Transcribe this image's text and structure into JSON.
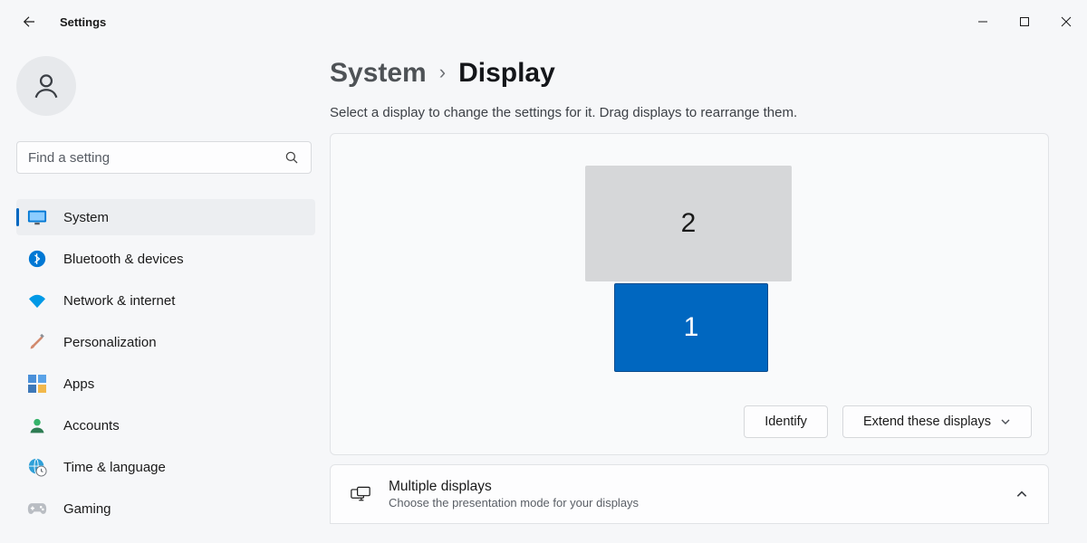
{
  "window": {
    "app_title": "Settings"
  },
  "search": {
    "placeholder": "Find a setting"
  },
  "nav": {
    "items": [
      {
        "id": "system",
        "label": "System",
        "selected": true
      },
      {
        "id": "bluetooth",
        "label": "Bluetooth & devices"
      },
      {
        "id": "network",
        "label": "Network & internet"
      },
      {
        "id": "personalization",
        "label": "Personalization"
      },
      {
        "id": "apps",
        "label": "Apps"
      },
      {
        "id": "accounts",
        "label": "Accounts"
      },
      {
        "id": "time",
        "label": "Time & language"
      },
      {
        "id": "gaming",
        "label": "Gaming"
      }
    ]
  },
  "breadcrumb": {
    "parent": "System",
    "current": "Display"
  },
  "description": "Select a display to change the settings for it. Drag displays to rearrange them.",
  "displays": {
    "monitor_primary_label": "1",
    "monitor_secondary_label": "2",
    "identify_label": "Identify",
    "mode_selected": "Extend these displays"
  },
  "multiple_displays": {
    "title": "Multiple displays",
    "subtitle": "Choose the presentation mode for your displays"
  }
}
